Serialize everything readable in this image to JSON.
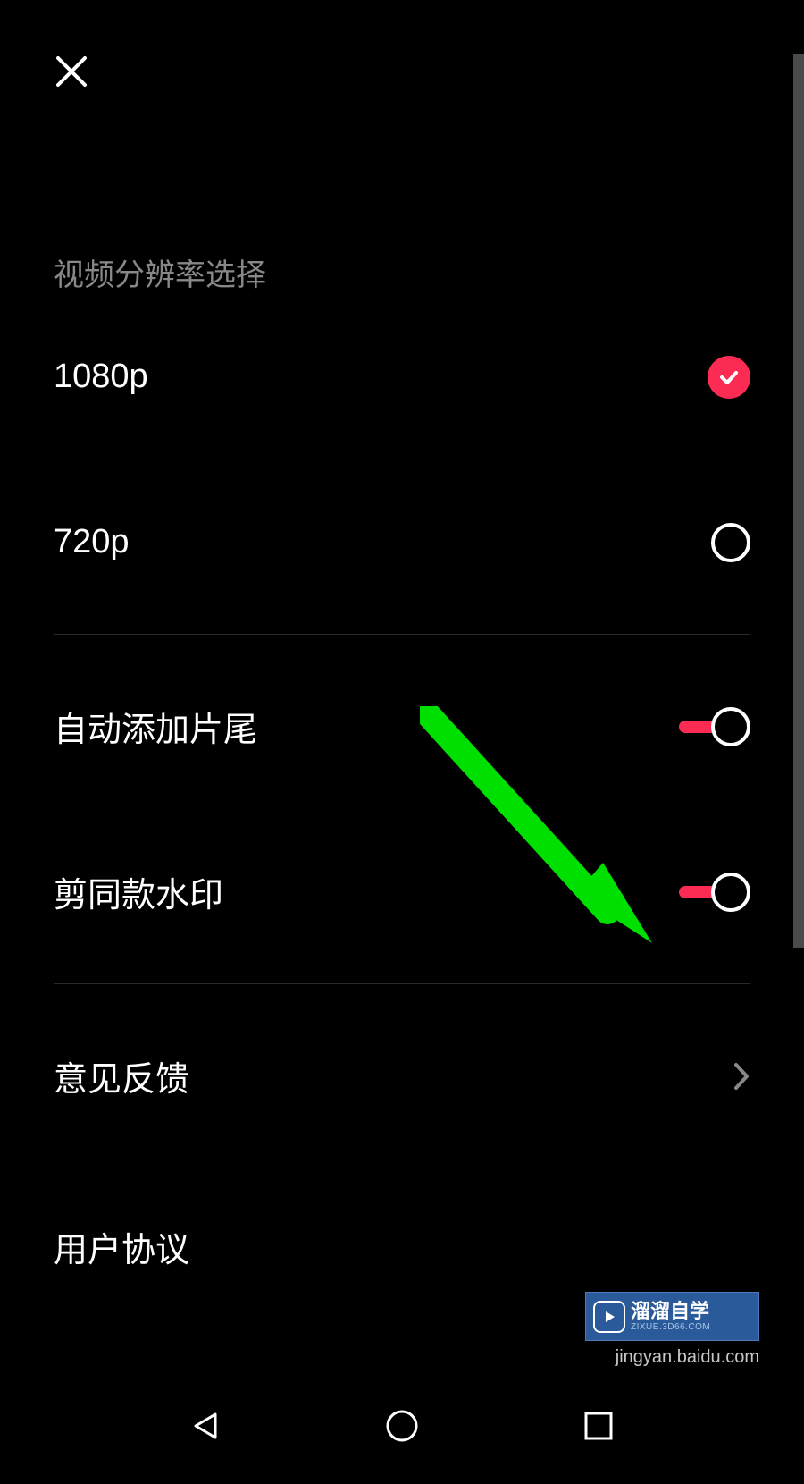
{
  "header": {
    "close_icon": "close"
  },
  "sections": {
    "resolution_title": "视频分辨率选择",
    "options": [
      {
        "label": "1080p",
        "selected": true
      },
      {
        "label": "720p",
        "selected": false
      }
    ],
    "toggles": [
      {
        "label": "自动添加片尾",
        "on": true
      },
      {
        "label": "剪同款水印",
        "on": true
      }
    ],
    "links": [
      {
        "label": "意见反馈"
      }
    ],
    "partial_label": "用户协议"
  },
  "watermark": {
    "brand": "溜溜自学",
    "sub": "ZIXUE.3D66.COM",
    "footer": "jingyan.baidu.com"
  },
  "colors": {
    "accent": "#fb2b54",
    "arrow": "#00e000"
  }
}
